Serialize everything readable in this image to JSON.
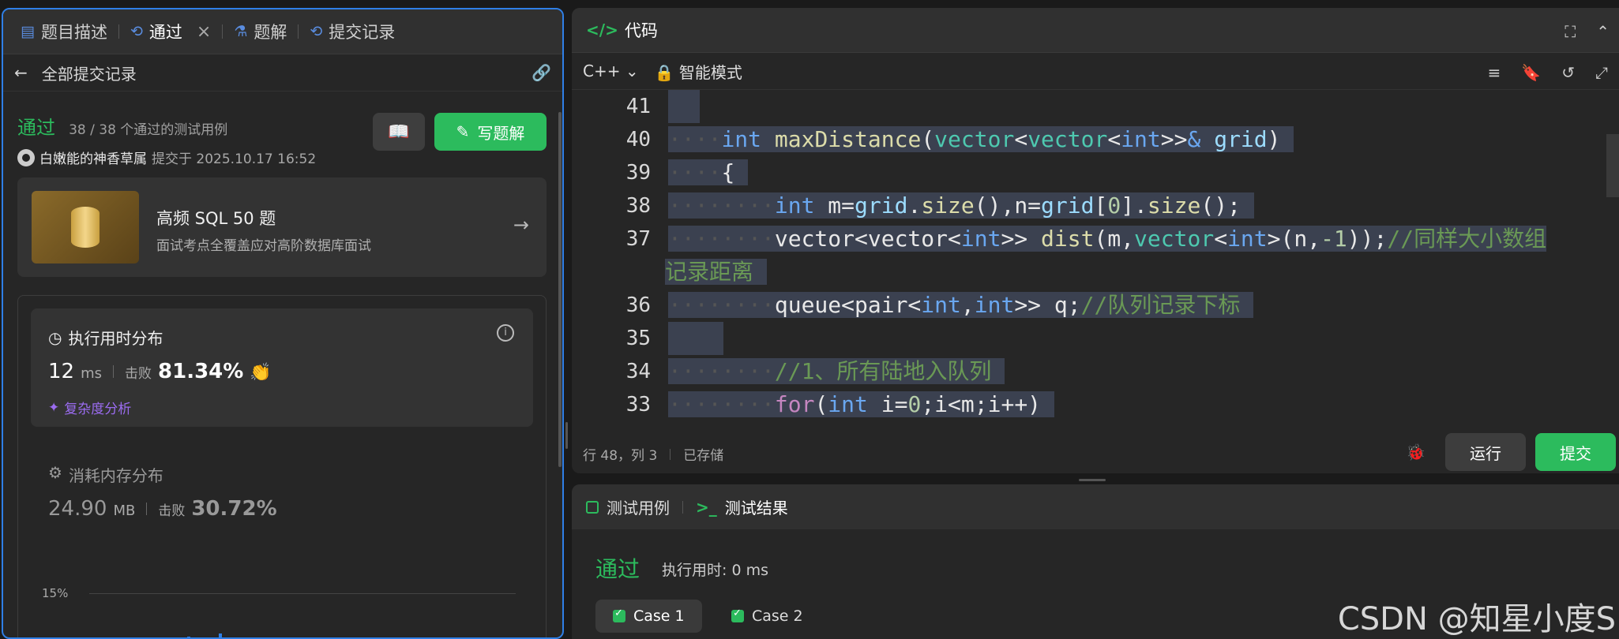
{
  "left_tabs": [
    {
      "label": "题目描述",
      "icon": "doc-icon"
    },
    {
      "label": "通过",
      "icon": "history-icon"
    },
    {
      "label": "题解",
      "icon": "flask-icon"
    },
    {
      "label": "提交记录",
      "icon": "history-icon"
    }
  ],
  "subbar": {
    "back_label": "全部提交记录"
  },
  "submission": {
    "status": "通过",
    "passed": "38 / 38 个通过的测试用例",
    "author": "白嫩能的神香草属",
    "submitted_at": "提交于 2025.10.17 16:52"
  },
  "buttons": {
    "write_solution": "写题解"
  },
  "promo": {
    "title": "高频 SQL 50 题",
    "subtitle": "面试考点全覆盖应对高阶数据库面试"
  },
  "runtime": {
    "title": "执行用时分布",
    "value": "12",
    "unit": "ms",
    "beat_label": "击败",
    "beat_pct": "81.34%",
    "complexity_link": "复杂度分析"
  },
  "memory": {
    "title": "消耗内存分布",
    "value": "24.90",
    "unit": "MB",
    "beat_label": "击败",
    "beat_pct": "30.72%"
  },
  "chart": {
    "tick_15": "15%"
  },
  "editor": {
    "title": "代码",
    "language": "C++",
    "mode": "智能模式",
    "status_pos": "行 48，列 3",
    "status_saved": "已存储",
    "run_label": "运行",
    "submit_label": "提交"
  },
  "code_lines": [
    {
      "ln": "41"
    },
    {
      "ln": "40"
    },
    {
      "ln": "39"
    },
    {
      "ln": "38"
    },
    {
      "ln": "37"
    },
    {
      "ln": ""
    },
    {
      "ln": "36"
    },
    {
      "ln": "35"
    },
    {
      "ln": "34"
    },
    {
      "ln": "33"
    }
  ],
  "results": {
    "tab_cases": "测试用例",
    "tab_results": "测试结果",
    "status": "通过",
    "exec_time": "执行用时: 0 ms",
    "cases": [
      "Case 1",
      "Case 2"
    ]
  },
  "watermark": "CSDN @知星小度S",
  "colors": {
    "accent_green": "#2cbb5d",
    "focus_blue": "#2f7fe6"
  }
}
